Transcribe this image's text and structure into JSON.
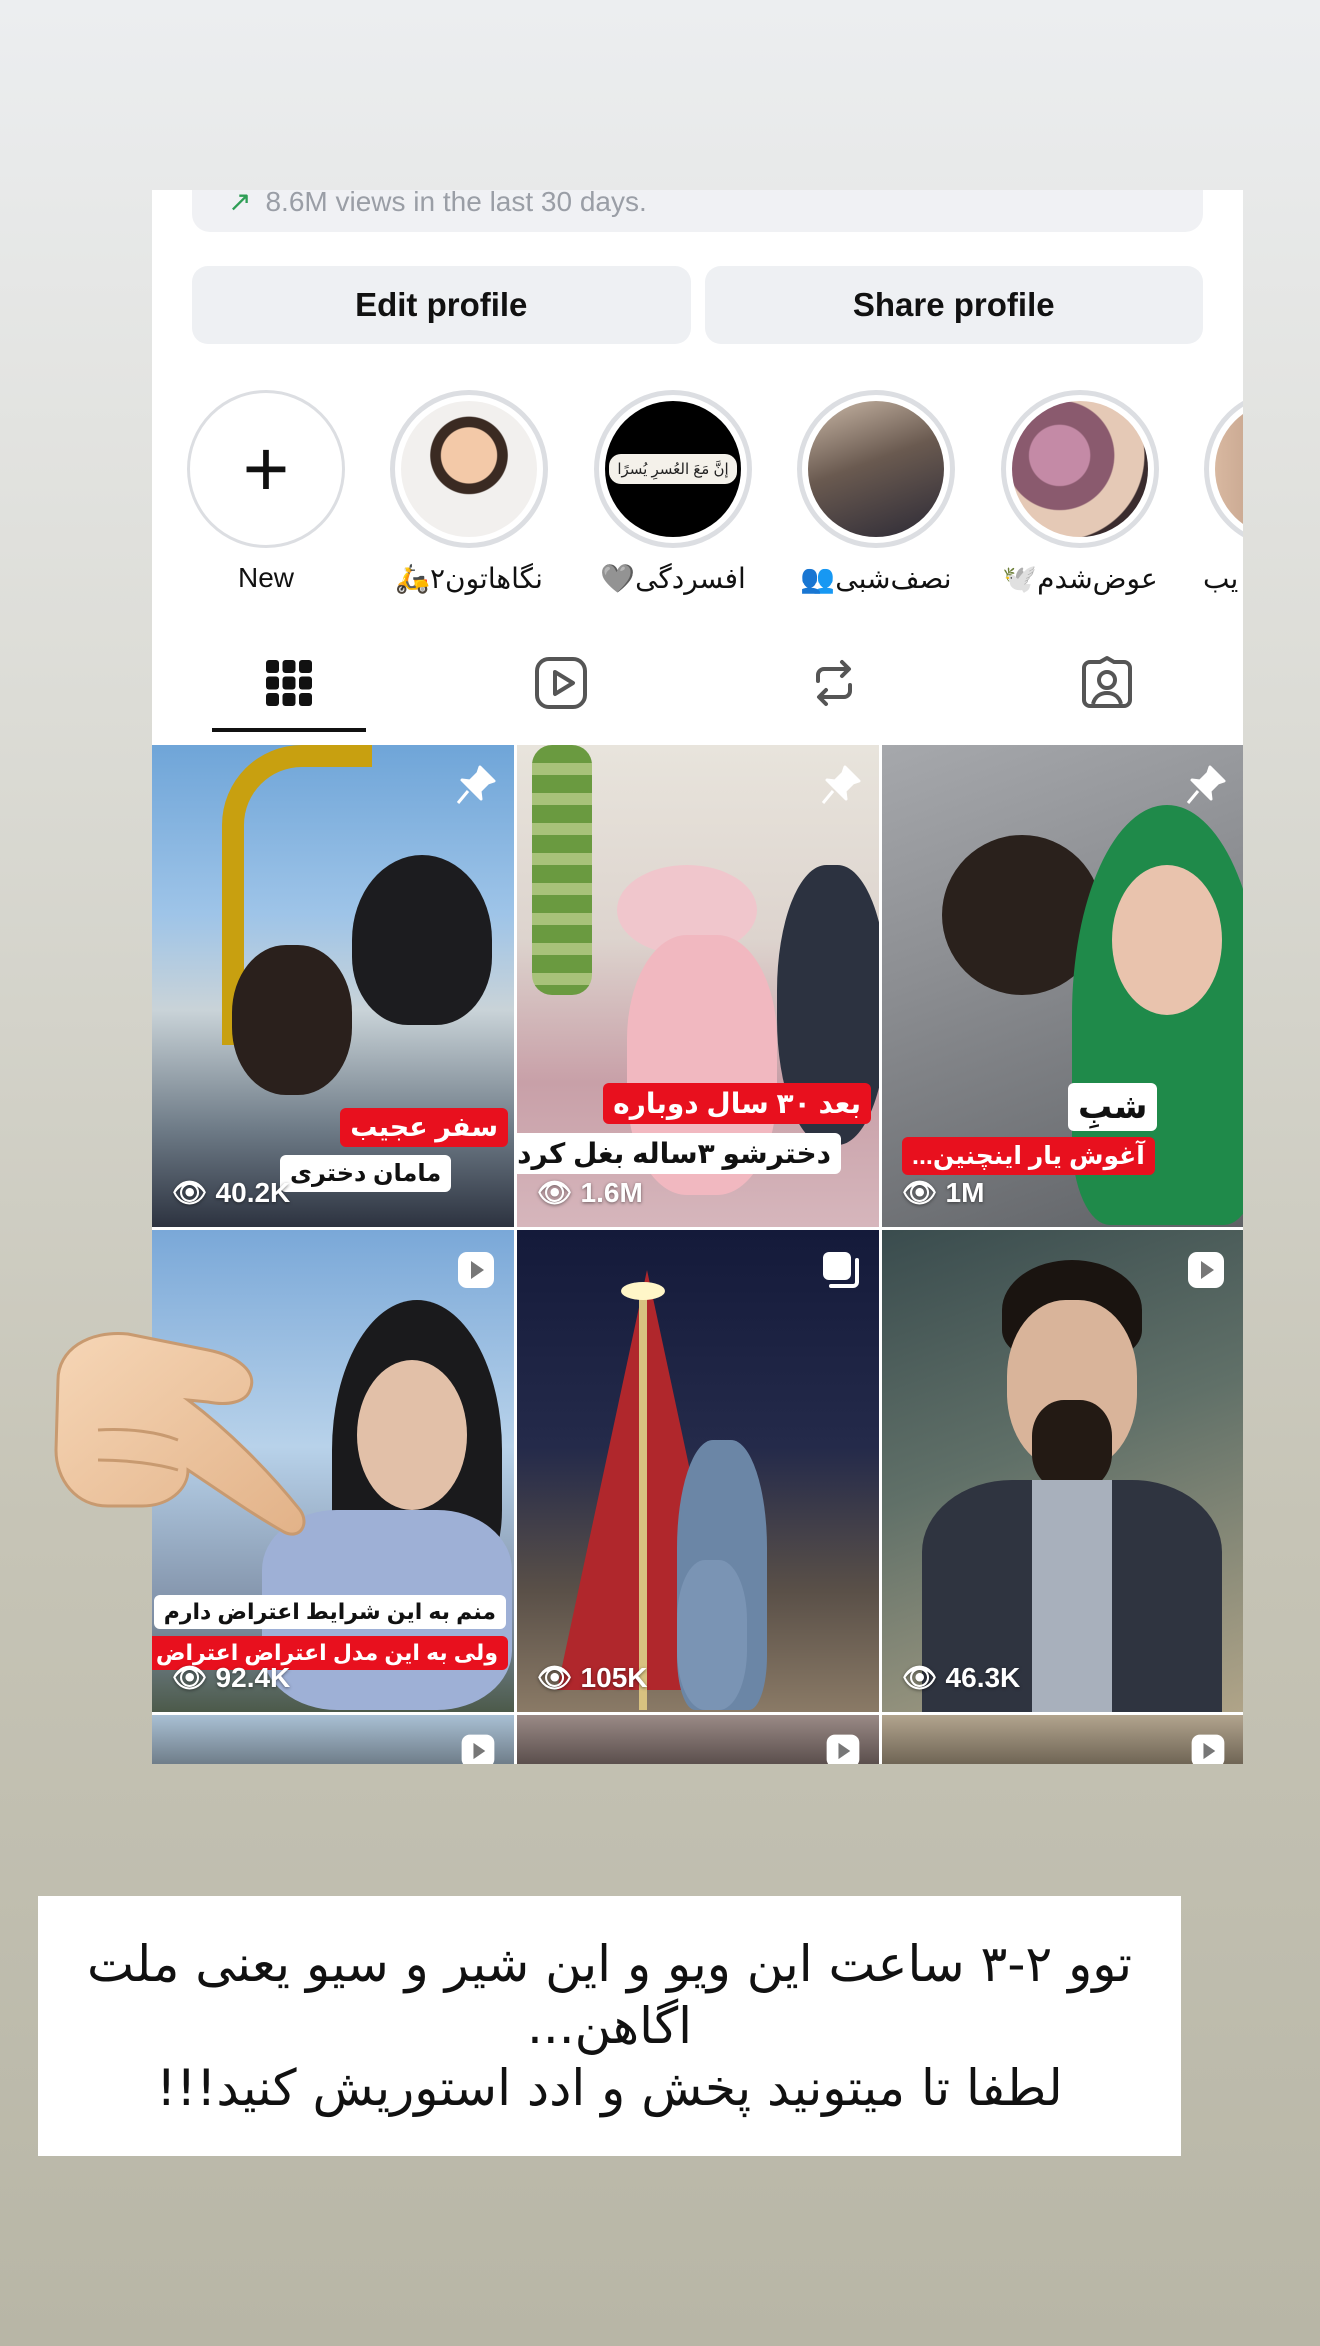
{
  "profile": {
    "views_text": "8.6M views in the last 30 days.",
    "edit_label": "Edit profile",
    "share_label": "Share profile"
  },
  "highlights": [
    {
      "label": "New"
    },
    {
      "label": "نگاهاتون۲🛵"
    },
    {
      "label": "افسردگی🩶"
    },
    {
      "label": "نصف‌شبی👥"
    },
    {
      "label": "عوض‌شدم🕊️"
    },
    {
      "label": "یب"
    }
  ],
  "highlight_badge_text": "إنَّ مَعَ العُسرِ يُسرًا",
  "tabs": [
    "grid-tab",
    "reels-tab",
    "reposts-tab",
    "tagged-tab"
  ],
  "posts": [
    {
      "views": "40.2K",
      "cap_red": "سفر عجیب",
      "cap_white": "مامان دختری"
    },
    {
      "views": "1.6M",
      "cap_red": "بعد ۳۰ سال دوباره",
      "cap_white": "دخترشو ۳ساله بغل کرد"
    },
    {
      "views": "1M",
      "cap_white": "شبِ",
      "cap_red": "آغوش یار اینچنین..."
    },
    {
      "views": "92.4K",
      "cap_white": "منم به این شرایط اعتراض دارم",
      "cap_red": "ولی به این مدل اعتراض اعتراض دارم"
    },
    {
      "views": "105K"
    },
    {
      "views": "46.3K"
    }
  ],
  "story_caption": {
    "line1": "توو ۲-۳ ساعت این ویو و این شیر و سیو یعنی ملت",
    "line2": "اگاهن...",
    "line3": "لطفا تا میتونید پخش و ادد استوریش کنید!!!"
  },
  "colors": {
    "accent_red": "#e8101e",
    "button_bg": "#eef0f3",
    "trend_green": "#2f9e56"
  }
}
